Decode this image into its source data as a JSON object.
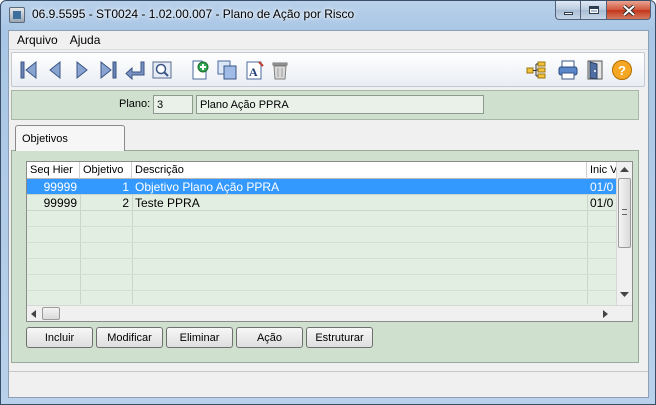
{
  "window": {
    "title": "06.9.5595 - ST0024 - 1.02.00.007 - Plano de Ação por Risco"
  },
  "menu": {
    "items": [
      "Arquivo",
      "Ajuda"
    ]
  },
  "toolbar": {
    "icons": [
      "first-record-icon",
      "previous-record-icon",
      "next-record-icon",
      "last-record-icon",
      "enter-icon",
      "zoom-search-icon",
      "new-document-icon",
      "copy-icon",
      "edit-document-icon",
      "delete-trash-icon",
      "hierarchy-tree-icon",
      "print-icon",
      "exit-door-icon",
      "help-icon"
    ]
  },
  "plano": {
    "label": "Plano:",
    "code": "3",
    "description": "Plano Ação PPRA"
  },
  "tabs": [
    {
      "label": "Objetivos"
    }
  ],
  "grid": {
    "columns": [
      "Seq Hier",
      "Objetivo",
      "Descrição",
      "Inic Va"
    ],
    "rows": [
      {
        "seq_hier": "99999",
        "objetivo": "1",
        "descricao": "Objetivo Plano Ação PPRA",
        "inic": "01/0",
        "selected": true
      },
      {
        "seq_hier": "99999",
        "objetivo": "2",
        "descricao": "Teste PPRA",
        "inic": "01/0",
        "selected": false
      }
    ]
  },
  "buttons": {
    "incluir": "Incluir",
    "modificar": "Modificar",
    "eliminar": "Eliminar",
    "acao": "Ação",
    "estruturar": "Estruturar"
  },
  "colors": {
    "panel_green": "#cfe0cf",
    "selection_blue": "#3399ff"
  }
}
